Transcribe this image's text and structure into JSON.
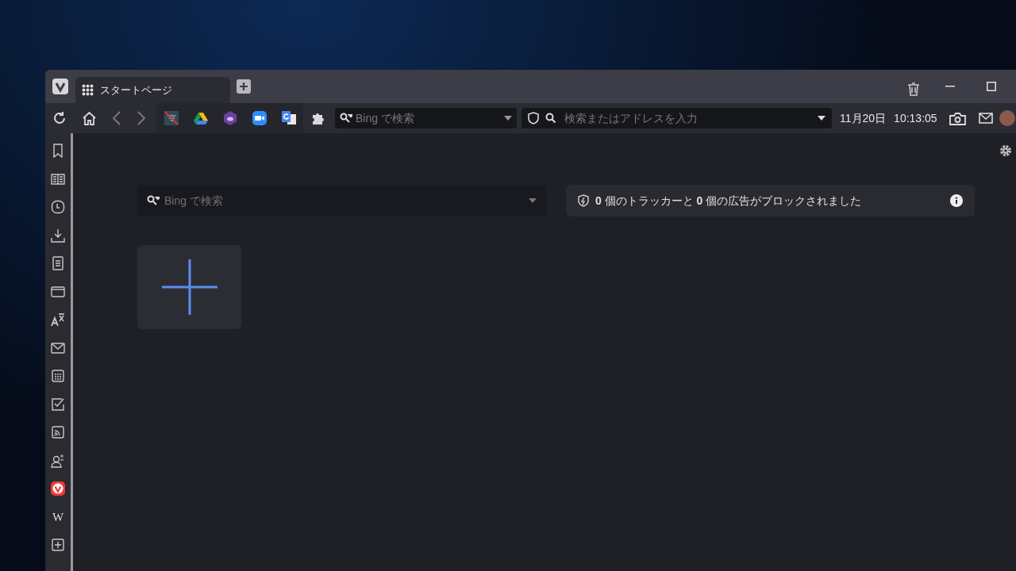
{
  "tabs": [
    {
      "label": "スタートページ",
      "selected": true
    }
  ],
  "toolbar": {
    "search": {
      "placeholder": "Bing で検索"
    },
    "address": {
      "placeholder": "検索またはアドレスを入力"
    },
    "date": "11月20日",
    "time": "10:13:05"
  },
  "sidebar": {
    "items": [
      {
        "kind": "bookmark"
      },
      {
        "kind": "reader"
      },
      {
        "kind": "history"
      },
      {
        "kind": "download"
      },
      {
        "kind": "notes"
      },
      {
        "kind": "window"
      },
      {
        "kind": "translate"
      },
      {
        "kind": "mail"
      },
      {
        "kind": "calendar"
      },
      {
        "kind": "tasks"
      },
      {
        "kind": "feed"
      },
      {
        "kind": "contacts"
      },
      {
        "kind": "vivaldi"
      },
      {
        "kind": "text",
        "label": "W"
      },
      {
        "kind": "add"
      }
    ]
  },
  "start_page": {
    "search": {
      "placeholder": "Bing で検索"
    },
    "blocked_message": "**0** 個のトラッカーと **0** 個の広告がブロックされました"
  }
}
